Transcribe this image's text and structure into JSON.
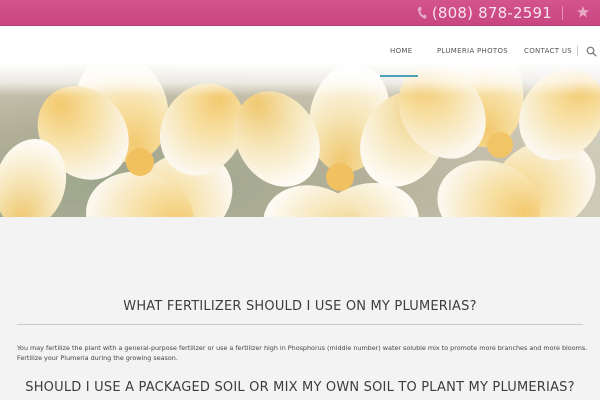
{
  "topbar": {
    "phone": "(808) 878-2591",
    "phone_icon": "phone-icon",
    "star_icon": "star-icon",
    "accent_color": "#d04f8a"
  },
  "nav": {
    "items": [
      {
        "label": "HOME",
        "active": true
      },
      {
        "label": "PLUMERIA PHOTOS",
        "active": false
      },
      {
        "label": "CONTACT US",
        "active": false
      }
    ],
    "search_icon": "search-icon",
    "active_color": "#4aa3b7"
  },
  "hero": {
    "image": "yellow-white plumeria flowers"
  },
  "content": {
    "q1_title": "WHAT FERTILIZER SHOULD I USE ON MY PLUMERIAS?",
    "q1_text_line1": "You may fertilize the plant with a general-purpose fertilizer or use a fertilizer high in Phosphorus (middle number) water soluble mix to promote more branches and more blooms.",
    "q1_text_line2": "Fertilize your Plumeria during the growing season.",
    "q2_title": "SHOULD I USE A PACKAGED SOIL OR MIX MY OWN SOIL TO PLANT MY PLUMERIAS?"
  }
}
